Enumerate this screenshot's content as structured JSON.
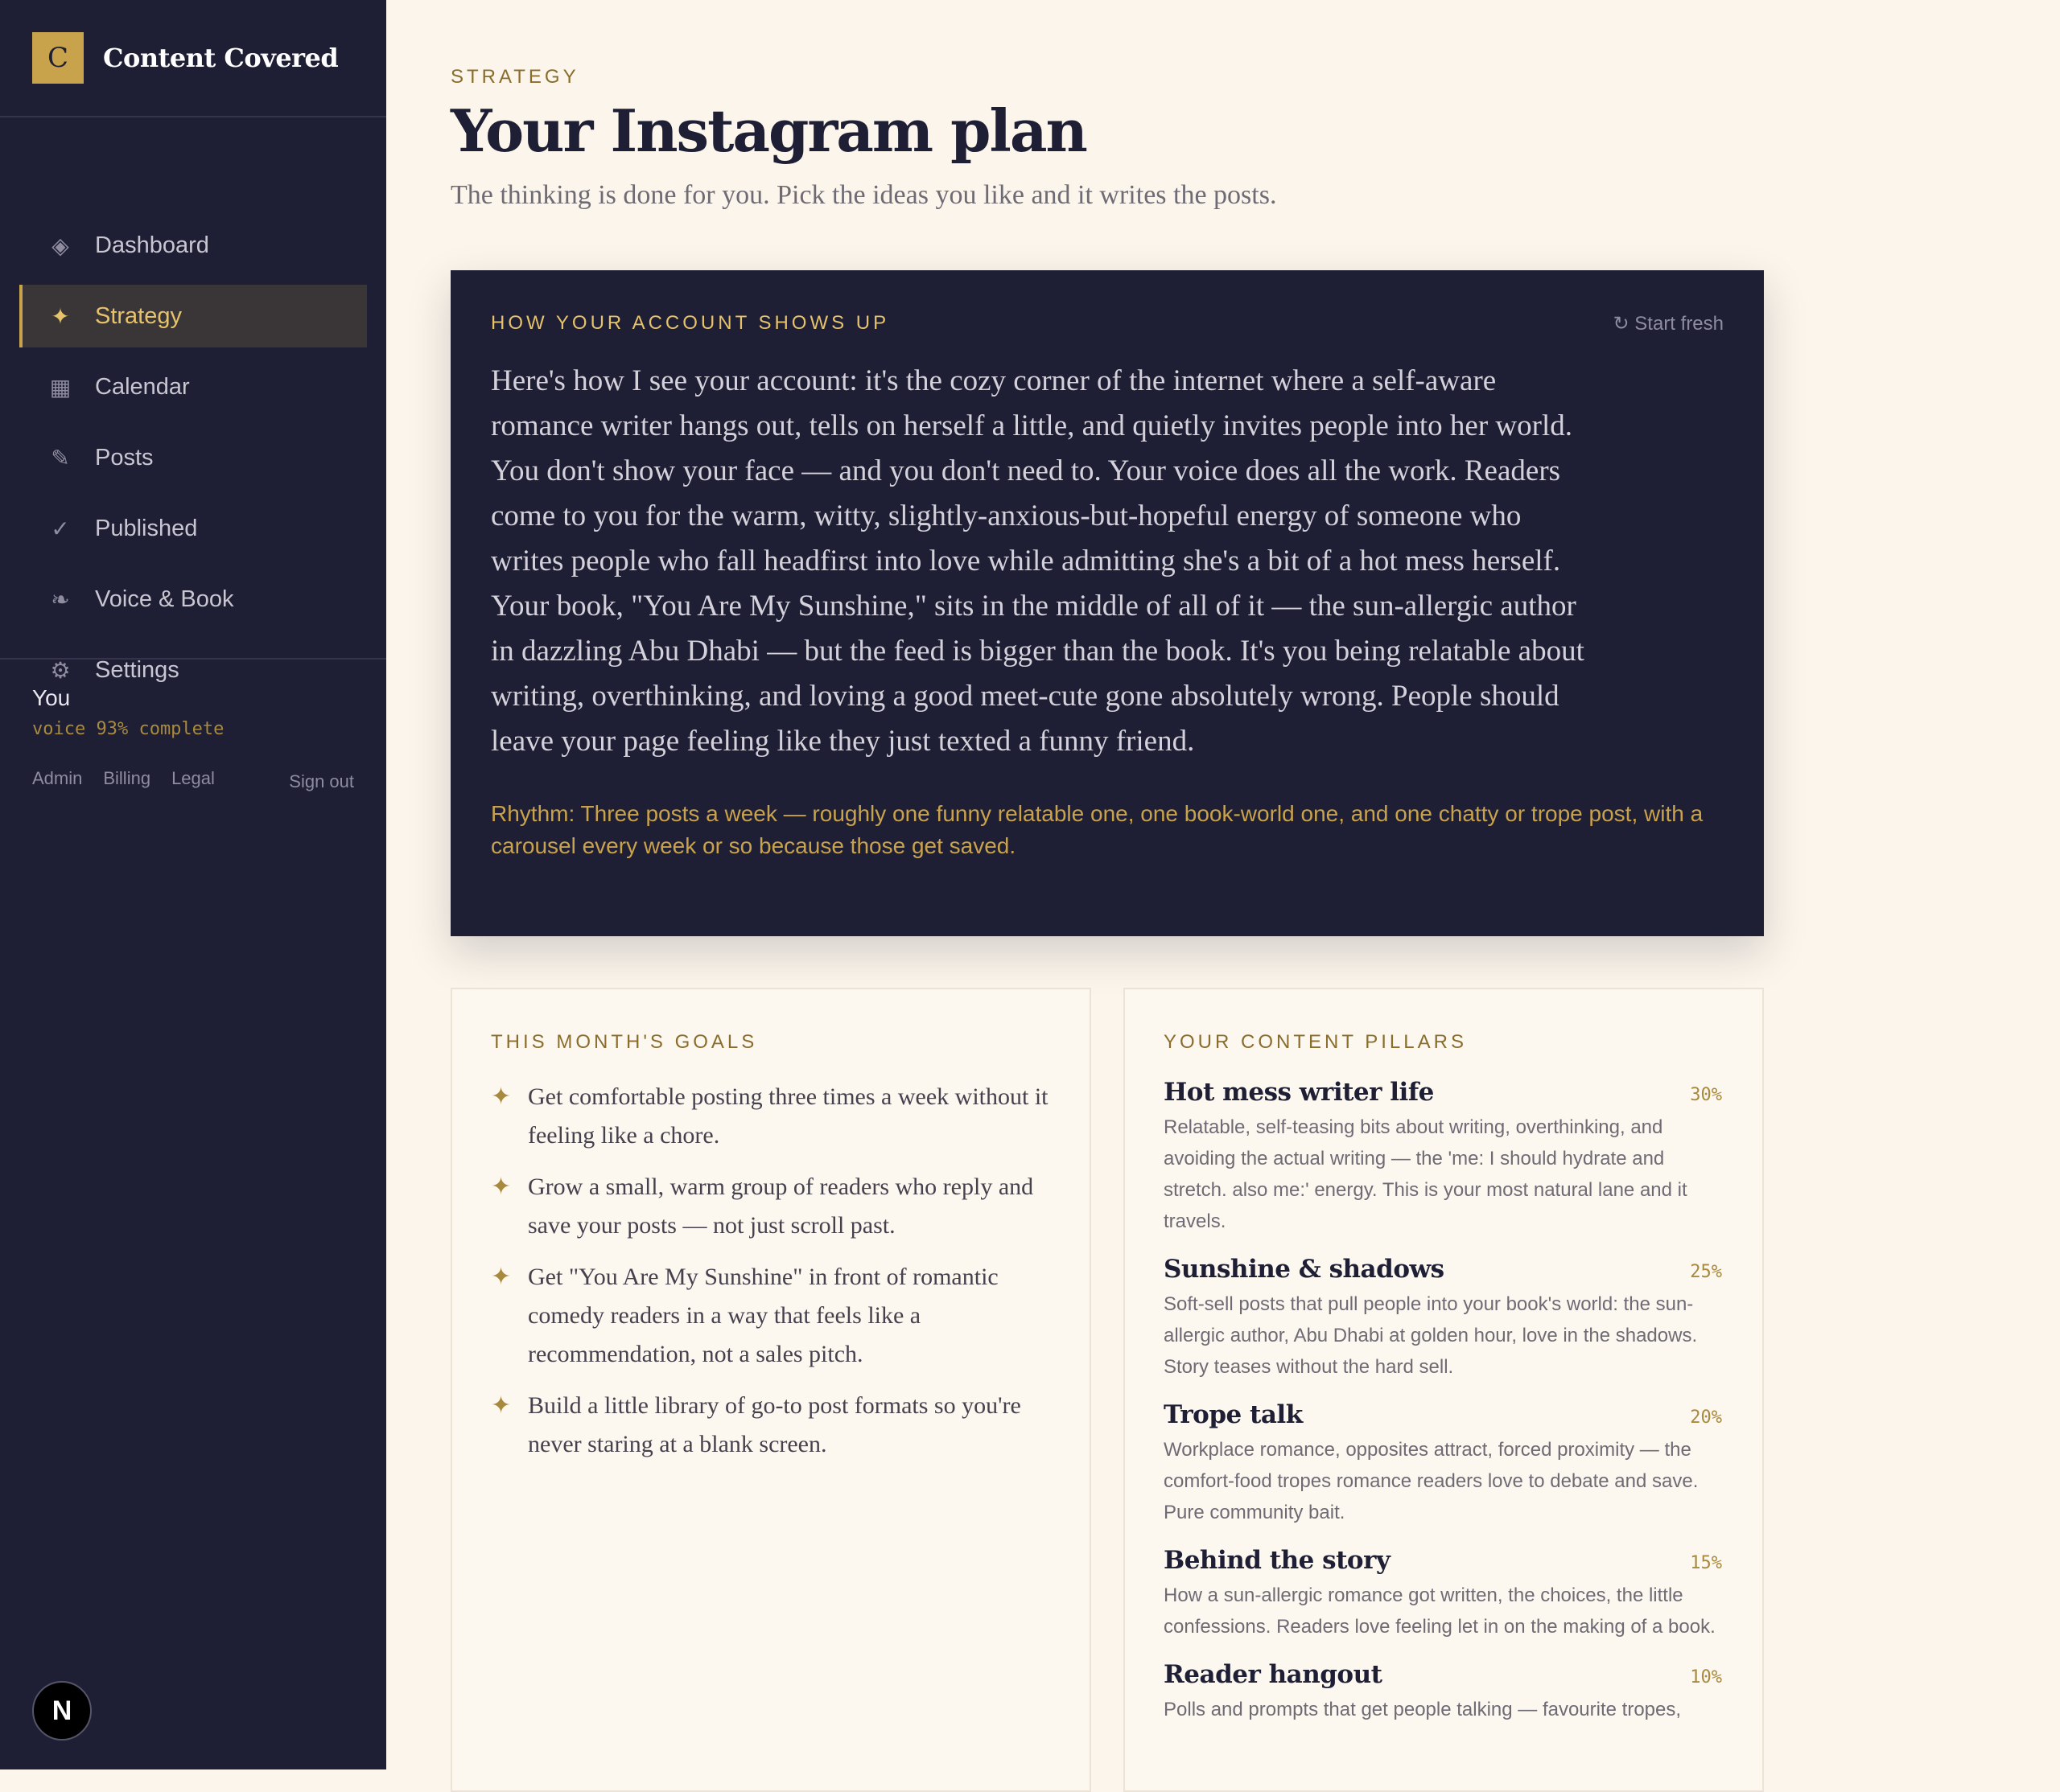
{
  "brand": {
    "logo_letter": "C",
    "name": "Content Covered"
  },
  "nav": {
    "items": [
      {
        "icon": "diamond-icon",
        "glyph": "◈",
        "label": "Dashboard"
      },
      {
        "icon": "sparkle-icon",
        "glyph": "✦",
        "label": "Strategy",
        "active": true
      },
      {
        "icon": "calendar-icon",
        "glyph": "▦",
        "label": "Calendar"
      },
      {
        "icon": "pencil-icon",
        "glyph": "✎",
        "label": "Posts"
      },
      {
        "icon": "check-icon",
        "glyph": "✓",
        "label": "Published"
      },
      {
        "icon": "fleuron-icon",
        "glyph": "❧",
        "label": "Voice & Book"
      },
      {
        "icon": "gear-icon",
        "glyph": "⚙",
        "label": "Settings"
      }
    ]
  },
  "user": {
    "name": "You",
    "progress": "voice 93% complete",
    "links": [
      "Admin",
      "Billing",
      "Legal"
    ],
    "sign_out": "Sign out"
  },
  "badge": {
    "letter": "N"
  },
  "header": {
    "eyebrow": "STRATEGY",
    "title": "Your Instagram plan",
    "subtitle": "The thinking is done for you. Pick the ideas you like and it writes the posts."
  },
  "hero": {
    "label": "HOW YOUR ACCOUNT SHOWS UP",
    "start_fresh": "↻ Start fresh",
    "text": "Here's how I see your account: it's the cozy corner of the internet where a self-aware romance writer hangs out, tells on herself a little, and quietly invites people into her world. You don't show your face — and you don't need to. Your voice does all the work. Readers come to you for the warm, witty, slightly-anxious-but-hopeful energy of someone who writes people who fall headfirst into love while admitting she's a bit of a hot mess herself. Your book, \"You Are My Sunshine,\" sits in the middle of all of it — the sun-allergic author in dazzling Abu Dhabi — but the feed is bigger than the book. It's you being relatable about writing, overthinking, and loving a good meet-cute gone absolutely wrong. People should leave your page feeling like they just texted a funny friend.",
    "rhythm": "Rhythm: Three posts a week — roughly one funny relatable one, one book-world one, and one chatty or trope post, with a carousel every week or so because those get saved."
  },
  "goals": {
    "label": "THIS MONTH'S GOALS",
    "items": [
      "Get comfortable posting three times a week without it feeling like a chore.",
      "Grow a small, warm group of readers who reply and save your posts — not just scroll past.",
      "Get \"You Are My Sunshine\" in front of romantic comedy readers in a way that feels like a recommendation, not a sales pitch.",
      "Build a little library of go-to post formats so you're never staring at a blank screen."
    ]
  },
  "pillars": {
    "label": "YOUR CONTENT PILLARS",
    "items": [
      {
        "title": "Hot mess writer life",
        "pct": "30%",
        "desc": "Relatable, self-teasing bits about writing, overthinking, and avoiding the actual writing — the 'me: I should hydrate and stretch. also me:' energy. This is your most natural lane and it travels."
      },
      {
        "title": "Sunshine & shadows",
        "pct": "25%",
        "desc": "Soft-sell posts that pull people into your book's world: the sun-allergic author, Abu Dhabi at golden hour, love in the shadows. Story teases without the hard sell."
      },
      {
        "title": "Trope talk",
        "pct": "20%",
        "desc": "Workplace romance, opposites attract, forced proximity — the comfort-food tropes romance readers love to debate and save. Pure community bait."
      },
      {
        "title": "Behind the story",
        "pct": "15%",
        "desc": "How a sun-allergic romance got written, the choices, the little confessions. Readers love feeling let in on the making of a book."
      },
      {
        "title": "Reader hangout",
        "pct": "10%",
        "desc": "Polls and prompts that get people talking — favourite tropes,"
      }
    ]
  },
  "colors": {
    "sidebar": "#1e1e34",
    "accent": "#c9a24c",
    "page": "#fbf5eb"
  }
}
